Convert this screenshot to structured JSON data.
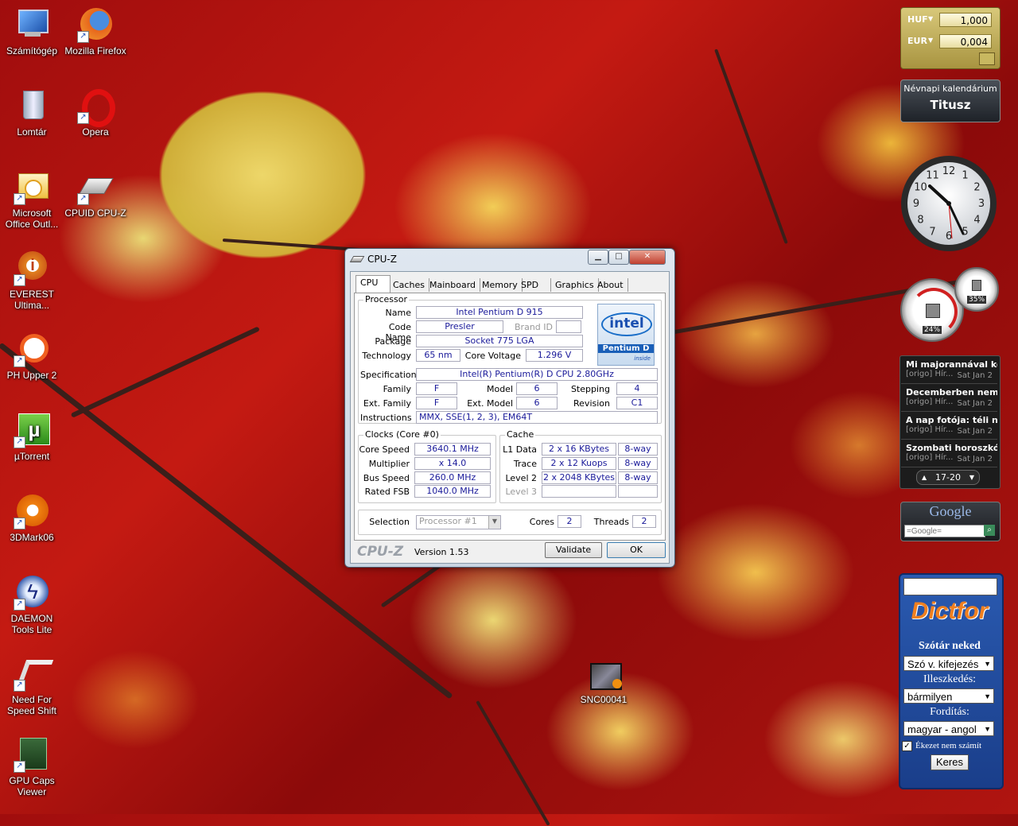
{
  "desktop_icons": [
    {
      "label": "Számítógép",
      "icon": "computer-icon"
    },
    {
      "label": "Mozilla Firefox",
      "icon": "firefox-icon"
    },
    {
      "label": "Lomtár",
      "icon": "recycle-bin-icon"
    },
    {
      "label": "Opera",
      "icon": "opera-icon"
    },
    {
      "label": "Microsoft Office Outl...",
      "icon": "outlook-icon"
    },
    {
      "label": "CPUID CPU-Z",
      "icon": "cpuz-icon"
    },
    {
      "label": "EVEREST Ultima...",
      "icon": "everest-icon"
    },
    {
      "label": "PH Upper 2",
      "icon": "phupper-icon"
    },
    {
      "label": "µTorrent",
      "icon": "utorrent-icon"
    },
    {
      "label": "3DMark06",
      "icon": "3dmark-icon"
    },
    {
      "label": "DAEMON Tools Lite",
      "icon": "daemon-tools-icon"
    },
    {
      "label": "Need For Speed Shift",
      "icon": "nfs-icon"
    },
    {
      "label": "GPU Caps Viewer",
      "icon": "gpu-caps-icon"
    },
    {
      "label": "SNC00041",
      "icon": "video-file-icon"
    }
  ],
  "currency": {
    "rows": [
      {
        "code": "HUF",
        "value": "1,000"
      },
      {
        "code": "EUR",
        "value": "0,004"
      }
    ]
  },
  "nameday": {
    "title": "Névnapi kalendárium",
    "name": "Titusz"
  },
  "clock": {
    "numbers": [
      "12",
      "1",
      "2",
      "3",
      "4",
      "5",
      "6",
      "7",
      "8",
      "9",
      "10",
      "11"
    ]
  },
  "meters": {
    "cpu": "24%",
    "mem": "35%"
  },
  "rss": {
    "items": [
      {
        "title": "Mi majorannával kés...",
        "source": "[origo] Hír...",
        "date": "Sat Jan 2"
      },
      {
        "title": "Decemberben nem v...",
        "source": "[origo] Hír...",
        "date": "Sat Jan 2"
      },
      {
        "title": "A nap fotója: téli nya...",
        "source": "[origo] Hír...",
        "date": "Sat Jan 2"
      },
      {
        "title": "Szombati horoszkóp",
        "source": "[origo] Hír...",
        "date": "Sat Jan 2"
      }
    ],
    "pager": "17-20"
  },
  "google": {
    "logo": "Google",
    "placeholder": "=Google="
  },
  "dictfor": {
    "logo": "Dictfor",
    "heading": "Szótár neked",
    "select1": "Szó v. kifejezés",
    "fit_label": "Illeszkedés:",
    "select2": "bármilyen",
    "translate_label": "Fordítás:",
    "select3": "magyar - angol",
    "checkbox_label": "Ékezet nem számít",
    "search_button": "Keres"
  },
  "cpuz": {
    "title": "CPU-Z",
    "tabs": [
      "CPU",
      "Caches",
      "Mainboard",
      "Memory",
      "SPD",
      "Graphics",
      "About"
    ],
    "processor_title": "Processor",
    "labels": {
      "name": "Name",
      "code_name": "Code Name",
      "brand_id": "Brand ID",
      "package": "Package",
      "technology": "Technology",
      "core_voltage": "Core Voltage",
      "specification": "Specification",
      "family": "Family",
      "model": "Model",
      "stepping": "Stepping",
      "ext_family": "Ext. Family",
      "ext_model": "Ext. Model",
      "revision": "Revision",
      "instructions": "Instructions"
    },
    "values": {
      "name": "Intel Pentium D 915",
      "code_name": "Presler",
      "package": "Socket 775 LGA",
      "technology": "65 nm",
      "core_voltage": "1.296 V",
      "specification": "Intel(R) Pentium(R) D CPU 2.80GHz",
      "family": "F",
      "model": "6",
      "stepping": "4",
      "ext_family": "F",
      "ext_model": "6",
      "revision": "C1",
      "instructions": "MMX, SSE(1, 2, 3), EM64T"
    },
    "logo": {
      "brand": "intel",
      "product": "Pentium D",
      "sub": "inside"
    },
    "clocks": {
      "title": "Clocks (Core #0)",
      "labels": [
        "Core Speed",
        "Multiplier",
        "Bus Speed",
        "Rated FSB"
      ],
      "values": [
        "3640.1 MHz",
        "x 14.0",
        "260.0 MHz",
        "1040.0 MHz"
      ]
    },
    "cache": {
      "title": "Cache",
      "rows": [
        {
          "label": "L1 Data",
          "size": "2 x 16 KBytes",
          "way": "8-way"
        },
        {
          "label": "Trace",
          "size": "2 x 12 Kuops",
          "way": "8-way"
        },
        {
          "label": "Level 2",
          "size": "2 x 2048 KBytes",
          "way": "8-way"
        },
        {
          "label": "Level 3",
          "size": "",
          "way": ""
        }
      ]
    },
    "selection": {
      "label": "Selection",
      "value": "Processor #1",
      "cores_label": "Cores",
      "cores": "2",
      "threads_label": "Threads",
      "threads": "2"
    },
    "footer": {
      "brand": "CPU-Z",
      "version": "Version 1.53",
      "validate": "Validate",
      "ok": "OK"
    }
  }
}
